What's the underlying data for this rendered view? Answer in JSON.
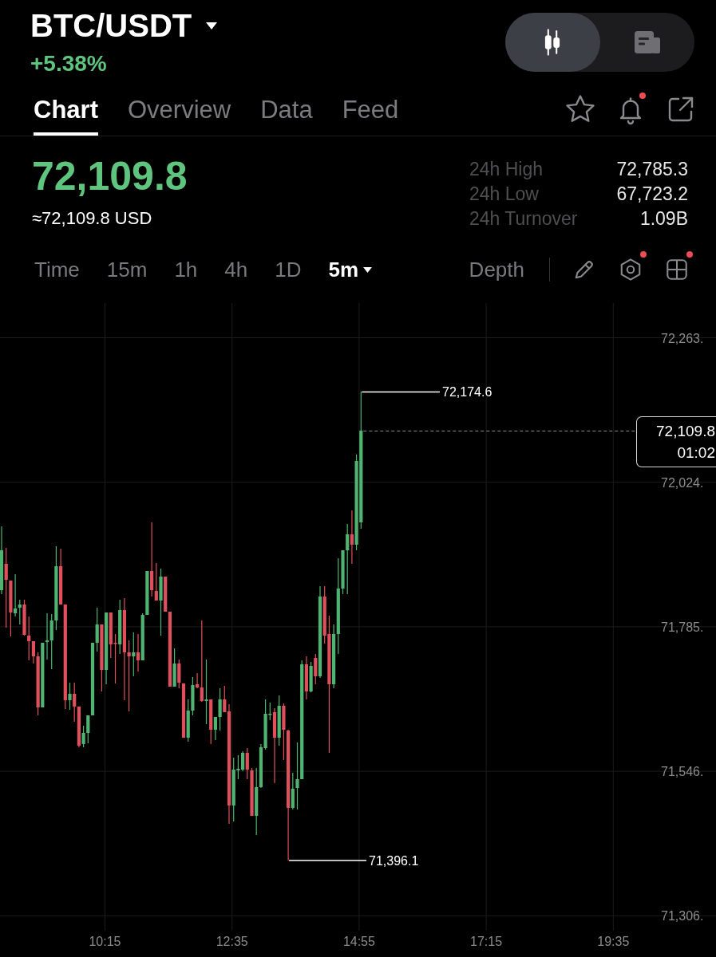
{
  "header": {
    "symbol": "BTC/USDT",
    "change": "+5.38%",
    "view_toggle": [
      {
        "kind": "chart",
        "selected": true
      },
      {
        "kind": "news",
        "selected": false
      }
    ]
  },
  "tabs": [
    {
      "label": "Chart",
      "selected": true
    },
    {
      "label": "Overview",
      "selected": false
    },
    {
      "label": "Data",
      "selected": false
    },
    {
      "label": "Feed",
      "selected": false
    }
  ],
  "tab_actions": [
    {
      "kind": "star",
      "badge": false
    },
    {
      "kind": "bell",
      "badge": true
    },
    {
      "kind": "share",
      "badge": false
    }
  ],
  "quote": {
    "last_price": "72,109.8",
    "converted": "≈72,109.8 USD",
    "stats": [
      {
        "label": "24h High",
        "value": "72,785.3"
      },
      {
        "label": "24h Low",
        "value": "67,723.2"
      },
      {
        "label": "24h Turnover",
        "value": "1.09B"
      }
    ]
  },
  "intervals": [
    {
      "label": "Time",
      "selected": false,
      "dropdown": false
    },
    {
      "label": "15m",
      "selected": false,
      "dropdown": false
    },
    {
      "label": "1h",
      "selected": false,
      "dropdown": false
    },
    {
      "label": "4h",
      "selected": false,
      "dropdown": false
    },
    {
      "label": "1D",
      "selected": false,
      "dropdown": false
    },
    {
      "label": "5m",
      "selected": true,
      "dropdown": true
    }
  ],
  "depth": "Depth",
  "tools": [
    {
      "kind": "pencil",
      "badge": false
    },
    {
      "kind": "indicators",
      "badge": true
    },
    {
      "kind": "layout",
      "badge": true
    }
  ],
  "chart": {
    "price_labels": [
      "72,263.",
      "72,024.",
      "71,785.",
      "71,546.",
      "71,306."
    ],
    "time_labels": [
      "10:15",
      "12:35",
      "14:55",
      "17:15",
      "19:35"
    ],
    "high_label": "72,174.6",
    "low_label": "71,396.1",
    "last_price": "72,109.8",
    "countdown": "01:02"
  }
}
